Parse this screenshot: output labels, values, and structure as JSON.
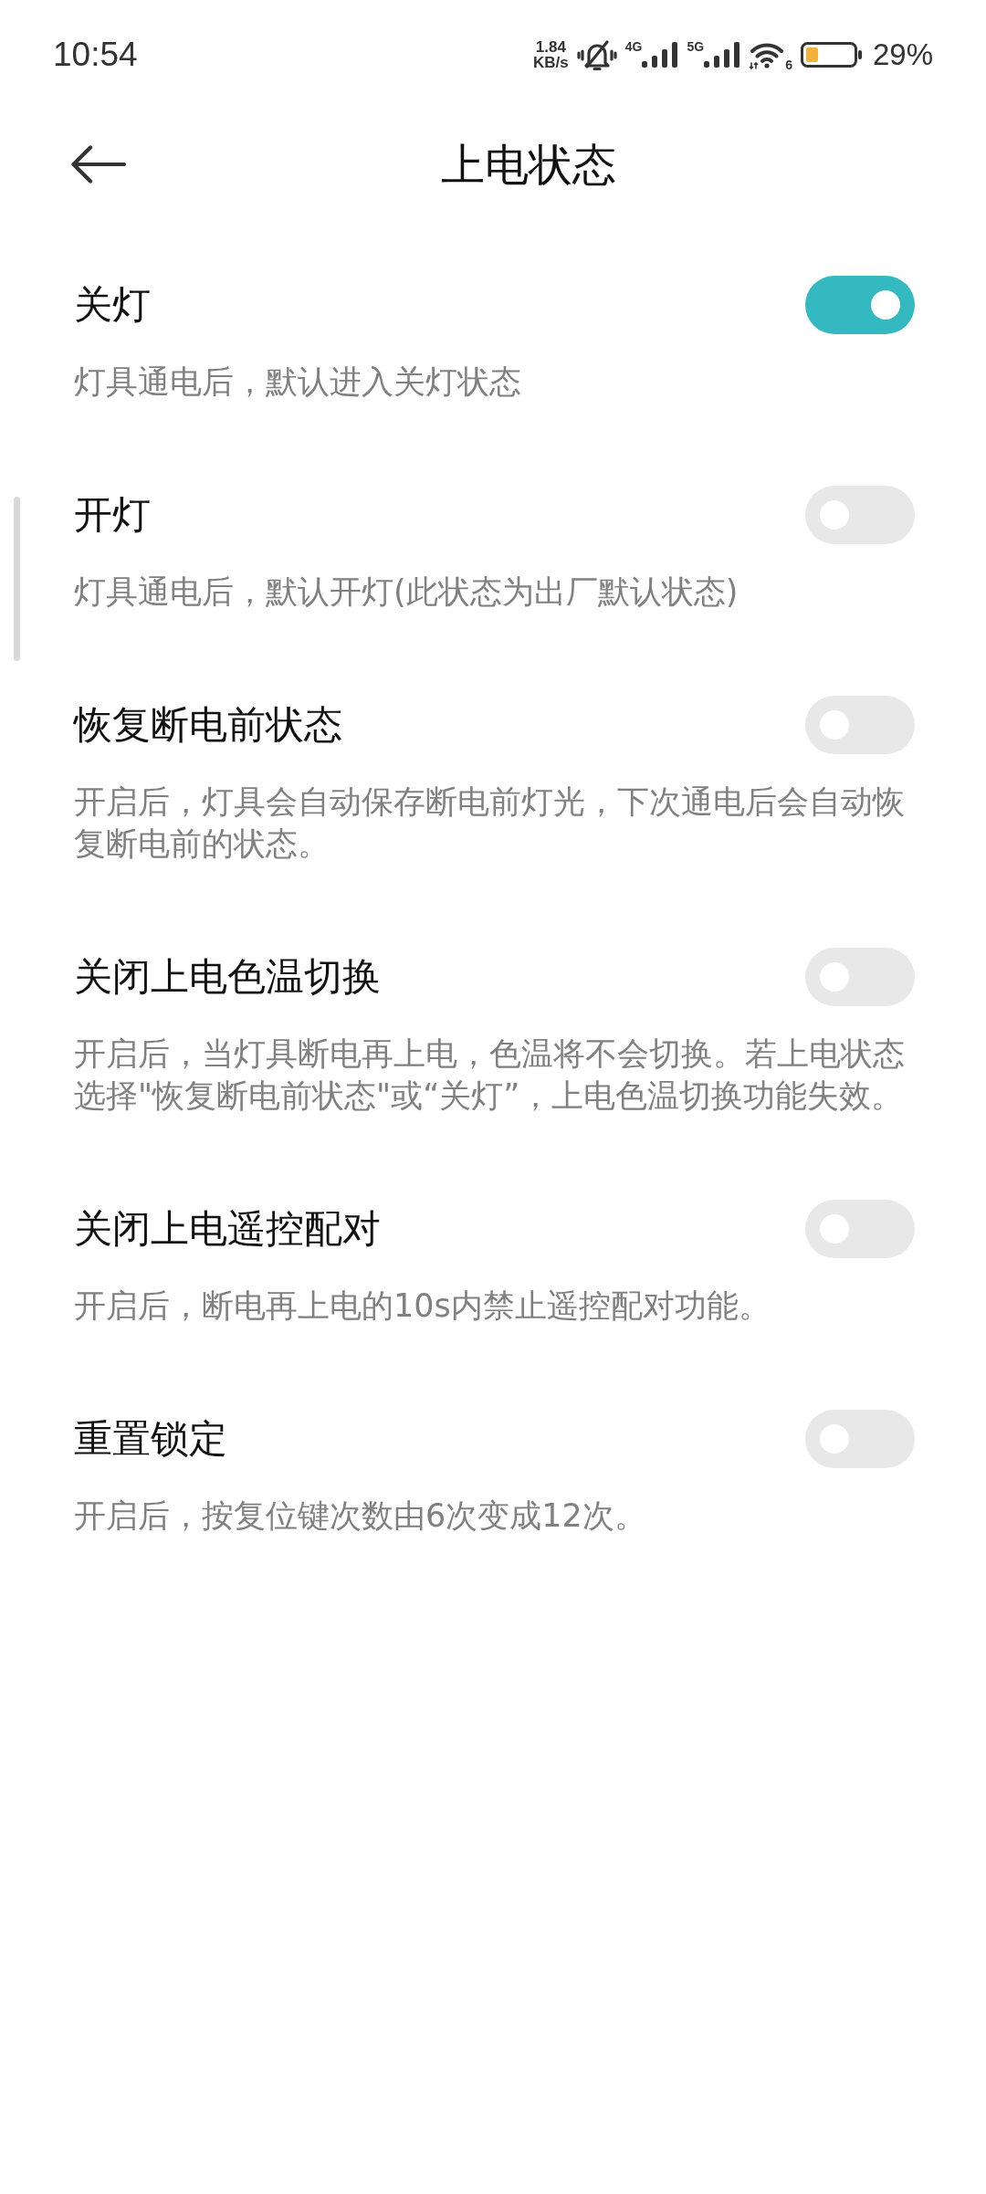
{
  "status_bar": {
    "time": "10:54",
    "net_speed": "1.84",
    "net_speed_unit": "KB/s",
    "signals": [
      {
        "label": "4G"
      },
      {
        "label": "5G"
      }
    ],
    "wifi_label": "6",
    "battery_percent": "29%"
  },
  "header": {
    "title": "上电状态"
  },
  "settings": [
    {
      "label": "关灯",
      "description": "灯具通电后，默认进入关灯状态",
      "on": true
    },
    {
      "label": "开灯",
      "description": "灯具通电后，默认开灯(此状态为出厂默认状态)",
      "on": false
    },
    {
      "label": "恢复断电前状态",
      "description": "开启后，灯具会自动保存断电前灯光，下次通电后会自动恢复断电前的状态。",
      "on": false
    },
    {
      "label": "关闭上电色温切换",
      "description": "开启后，当灯具断电再上电，色温将不会切换。若上电状态选择\"恢复断电前状态\"或“关灯”，上电色温切换功能失效。",
      "on": false
    },
    {
      "label": "关闭上电遥控配对",
      "description": "开启后，断电再上电的10s内禁止遥控配对功能。",
      "on": false
    },
    {
      "label": "重置锁定",
      "description": "开启后，按复位键次数由6次变成12次。",
      "on": false
    }
  ]
}
